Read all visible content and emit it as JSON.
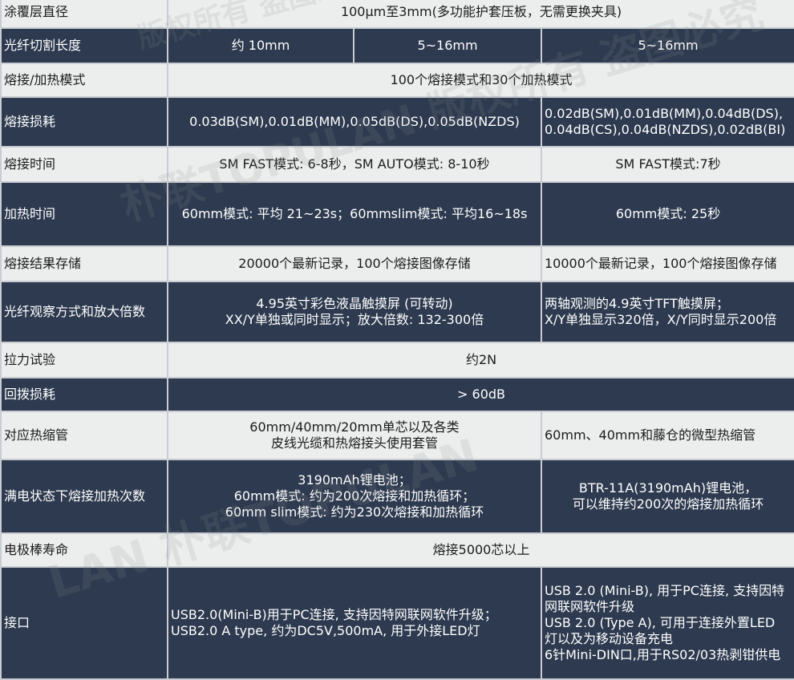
{
  "colors": {
    "dark_row": "#2d3a4f",
    "light_row": "#eceded",
    "border": "#c9ccd1"
  },
  "watermarks": [
    "朴联TOPULAN 版权所有 盗图必究",
    "版权所有 盗图必究",
    "LAN 朴联TOPULAN"
  ],
  "rows": [
    {
      "label": "涂覆层直径",
      "cells": [
        {
          "lines": [
            "100μm至3mm(多功能护套压板，无需更换夹具)"
          ],
          "span": 3
        }
      ]
    },
    {
      "label": "光纤切割长度",
      "cells": [
        {
          "lines": [
            "约 10mm"
          ],
          "span": 1
        },
        {
          "lines": [
            "5~16mm"
          ],
          "span": 1
        },
        {
          "lines": [
            "5~16mm"
          ],
          "span": 1
        }
      ]
    },
    {
      "label": "熔接/加热模式",
      "cells": [
        {
          "lines": [
            "100个熔接模式和30个加热模式"
          ],
          "span": 3
        }
      ]
    },
    {
      "label": "熔接损耗",
      "cells": [
        {
          "lines": [
            "0.03dB(SM),0.01dB(MM),0.05dB(DS),0.05dB(NZDS)"
          ],
          "span": 2
        },
        {
          "lines": [
            "0.02dB(SM),0.01dB(MM),0.04dB(DS),",
            "0.04dB(CS),0.04dB(NZDS),0.02dB(BI)"
          ],
          "span": 1,
          "align": "left"
        }
      ]
    },
    {
      "label": "熔接时间",
      "cells": [
        {
          "lines": [
            "SM FAST模式: 6-8秒，SM AUTO模式: 8-10秒"
          ],
          "span": 2
        },
        {
          "lines": [
            "SM FAST模式:7秒"
          ],
          "span": 1
        }
      ]
    },
    {
      "label": "加热时间",
      "cells": [
        {
          "lines": [
            "60mm模式: 平均 21~23s；60mmslim模式: 平均16~18s"
          ],
          "span": 2
        },
        {
          "lines": [
            "60mm模式: 25秒"
          ],
          "span": 1
        }
      ]
    },
    {
      "label": "熔接结果存储",
      "cells": [
        {
          "lines": [
            "20000个最新记录，100个熔接图像存储"
          ],
          "span": 2
        },
        {
          "lines": [
            "10000个最新记录，100个熔接图像存储"
          ],
          "span": 1,
          "align": "left"
        }
      ]
    },
    {
      "label": "光纤观察方式和放大倍数",
      "cells": [
        {
          "lines": [
            "4.95英寸彩色液晶触摸屏 (可转动)",
            "XX/Y单独或同时显示；放大倍数: 132-300倍"
          ],
          "span": 2
        },
        {
          "lines": [
            "两轴观测的4.9英寸TFT触摸屏；",
            "X/Y单独显示320倍，X/Y同时显示200倍"
          ],
          "span": 1,
          "align": "left"
        }
      ]
    },
    {
      "label": "拉力试验",
      "cells": [
        {
          "lines": [
            "约2N"
          ],
          "span": 3
        }
      ]
    },
    {
      "label": "回拨损耗",
      "cells": [
        {
          "lines": [
            "> 60dB"
          ],
          "span": 3
        }
      ]
    },
    {
      "label": "对应热缩管",
      "cells": [
        {
          "lines": [
            "60mm/40mm/20mm单芯以及各类",
            "皮线光缆和热熔接头使用套管"
          ],
          "span": 2
        },
        {
          "lines": [
            "60mm、40mm和藤仓的微型热缩管"
          ],
          "span": 1,
          "align": "left"
        }
      ]
    },
    {
      "label": "满电状态下熔接加热次数",
      "cells": [
        {
          "lines": [
            "3190mAh锂电池；",
            "60mm模式: 约为200次熔接和加热循环；",
            "60mm slim模式: 约为230次熔接和加热循环"
          ],
          "span": 2
        },
        {
          "lines": [
            "BTR-11A(3190mAh)锂电池，",
            "可以维持约200次的熔接加热循环"
          ],
          "span": 1
        }
      ]
    },
    {
      "label": "电极棒寿命",
      "cells": [
        {
          "lines": [
            "熔接5000芯以上"
          ],
          "span": 3
        }
      ]
    },
    {
      "label": "接口",
      "cells": [
        {
          "lines": [
            "USB2.0(Mini-B)用于PC连接, 支持因特网联网软件升级；",
            "USB2.0 A type, 约为DC5V,500mA, 用于外接LED灯"
          ],
          "span": 2,
          "align": "left"
        },
        {
          "lines": [
            "USB 2.0 (Mini-B), 用于PC连接, 支持因特",
            "网联网软件升级",
            "USB 2.0 (Type A), 可用于连接外置LED",
            "灯以及为移动设备充电",
            "6针Mini-DIN口,用于RS02/03热剥钳供电"
          ],
          "span": 1,
          "align": "left"
        }
      ]
    }
  ]
}
